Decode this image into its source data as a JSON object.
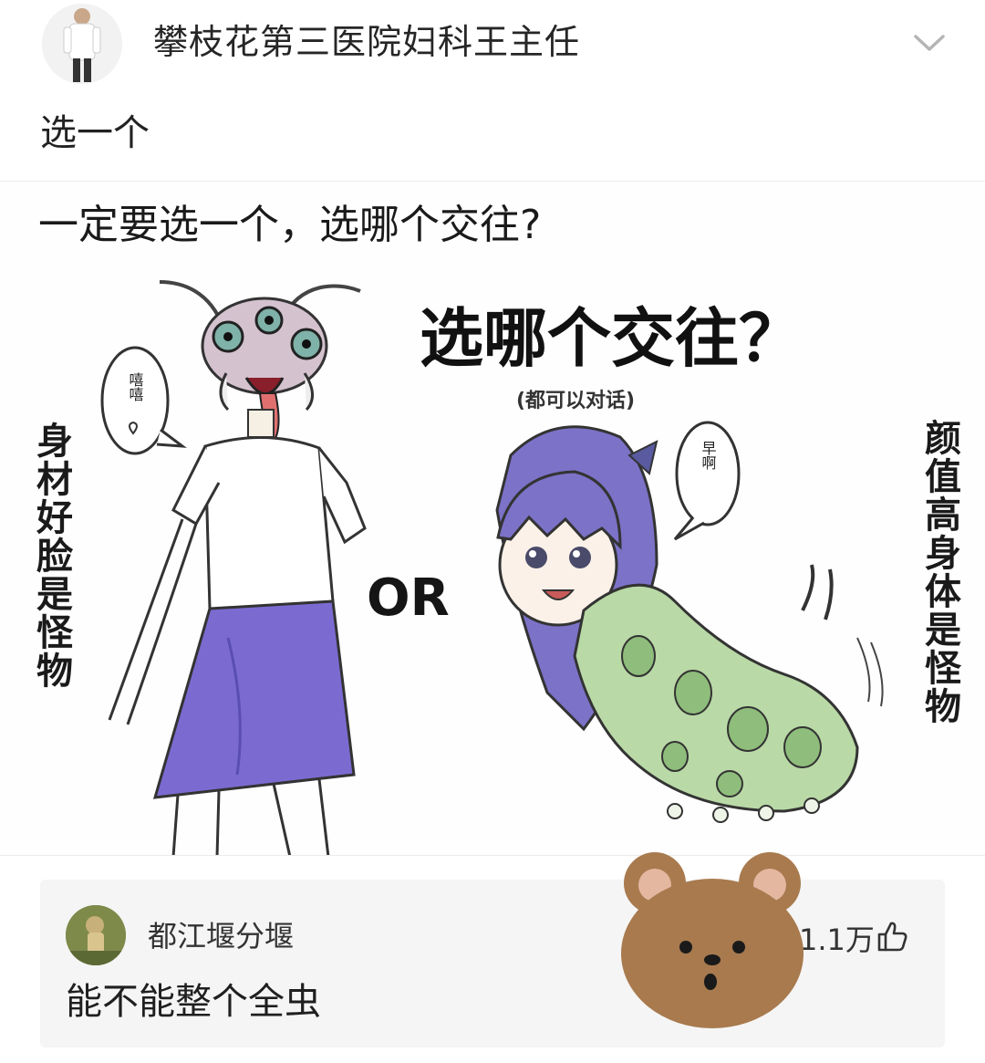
{
  "post": {
    "author": "攀枝花第三医院妇科王主任",
    "text": "选一个"
  },
  "image": {
    "question": "一定要选一个，选哪个交往?",
    "title": "选哪个交往？",
    "subtitle": "(都可以对话)",
    "left_caption": "身材好脸是怪物",
    "right_caption": "颜值高身体是怪物",
    "or": "OR",
    "left_bubble": "嘻嘻♡",
    "right_bubble": "早啊♪"
  },
  "comment": {
    "username": "都江堰分堰",
    "text": "能不能整个全虫",
    "likes": "1.1万"
  },
  "colors": {
    "skirt": "#7b6bd1",
    "hair": "#7c72c8",
    "caterpillar": "#b9d9a6",
    "bear": "#a87a4e"
  }
}
